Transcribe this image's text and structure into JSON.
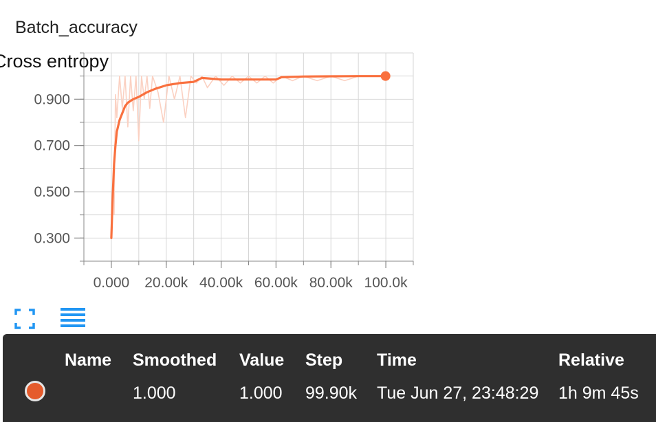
{
  "card": {
    "title": "Batch_accuracy"
  },
  "colors": {
    "smoothed": "#f9703e",
    "raw": "#fbd1c2",
    "grid": "#d6d6d6",
    "axis": "#888888",
    "tooltip_bg": "#2f2f2f",
    "toolbar_icon": "#2196f3"
  },
  "toolbar": {
    "expand_icon": "fullscreen-icon",
    "menu_icon": "menu-icon"
  },
  "chart_data": {
    "type": "line",
    "title": "Batch_accuracy",
    "xlabel": "",
    "ylabel": "",
    "xlim": [
      -10000,
      110000
    ],
    "ylim": [
      0.2,
      1.1
    ],
    "x_ticks": [
      0,
      20000,
      40000,
      60000,
      80000,
      100000
    ],
    "x_tick_labels": [
      "0.000",
      "20.00k",
      "40.00k",
      "60.00k",
      "80.00k",
      "100.0k"
    ],
    "y_ticks": [
      0.3,
      0.5,
      0.7,
      0.9
    ],
    "y_tick_labels": [
      "0.300",
      "0.500",
      "0.700",
      "0.900"
    ],
    "grid": true,
    "series": [
      {
        "kind": "smoothed",
        "x": [
          0,
          500,
          1000,
          1500,
          2000,
          3000,
          4000,
          5000,
          6000,
          8000,
          10000,
          13000,
          16000,
          20000,
          25000,
          30000,
          33000,
          35000,
          40000,
          50000,
          60000,
          62000,
          70000,
          80000,
          90000,
          99900
        ],
        "y": [
          0.3,
          0.48,
          0.62,
          0.7,
          0.76,
          0.81,
          0.84,
          0.87,
          0.885,
          0.9,
          0.91,
          0.93,
          0.945,
          0.96,
          0.97,
          0.975,
          0.992,
          0.99,
          0.985,
          0.985,
          0.985,
          0.995,
          0.998,
          0.999,
          1.0,
          1.0
        ]
      },
      {
        "kind": "raw",
        "x": [
          1000,
          1500,
          2000,
          3000,
          4000,
          5000,
          6000,
          7000,
          8000,
          9000,
          10000,
          11000,
          12000,
          13000,
          14000,
          15000,
          17000,
          19000,
          21000,
          23000,
          25000,
          27000,
          29000,
          31000,
          33000,
          35000,
          38000,
          41000,
          44000,
          47000,
          50000,
          53000,
          56000,
          59000,
          62000,
          66000,
          70000,
          75000,
          80000,
          85000,
          90000,
          95000,
          99900
        ],
        "y": [
          0.4,
          0.92,
          0.82,
          1.0,
          0.86,
          1.0,
          0.78,
          1.0,
          0.85,
          1.0,
          0.72,
          1.0,
          0.9,
          1.0,
          0.86,
          1.0,
          0.93,
          0.8,
          1.0,
          0.9,
          1.0,
          0.82,
          1.0,
          0.97,
          1.0,
          0.95,
          1.0,
          0.96,
          1.0,
          0.97,
          1.0,
          0.97,
          1.0,
          0.97,
          1.0,
          0.98,
          1.0,
          0.98,
          1.0,
          0.98,
          1.0,
          1.0,
          1.0
        ]
      }
    ],
    "highlight": {
      "x": 99900,
      "y": 1.0
    }
  },
  "tooltip": {
    "headers": [
      "Name",
      "Smoothed",
      "Value",
      "Step",
      "Time",
      "Relative"
    ],
    "row": {
      "name": "Cross entropy",
      "smoothed": "1.000",
      "value": "1.000",
      "step": "99.90k",
      "time": "Tue Jun 27, 23:48:29",
      "relative": "1h 9m 45s"
    }
  }
}
